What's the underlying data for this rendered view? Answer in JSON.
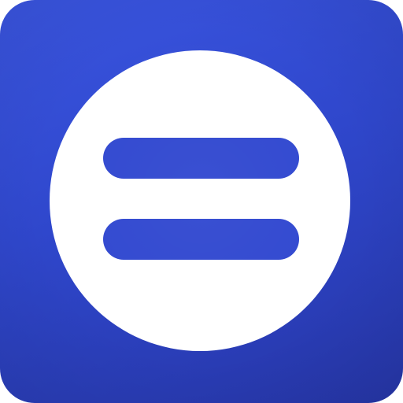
{
  "icon": {
    "name": "equals-icon",
    "colors": {
      "background_top": "#3a55e0",
      "background_bottom": "#2636a8",
      "circle": "#ffffff",
      "bars": "#3249d0"
    }
  }
}
